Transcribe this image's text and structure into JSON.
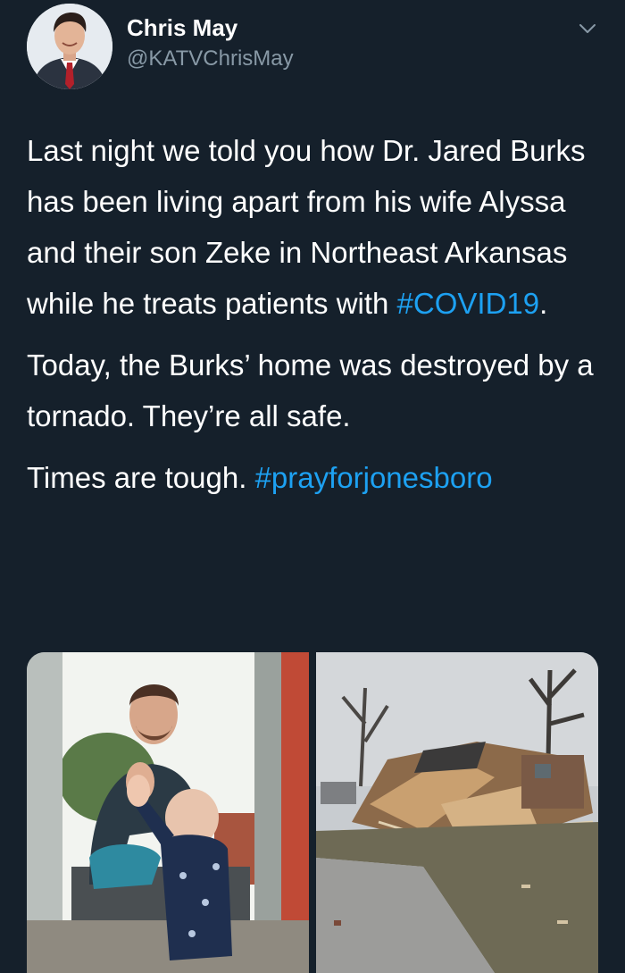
{
  "user": {
    "display_name": "Chris May",
    "handle": "@KATVChrisMay"
  },
  "tweet": {
    "p1_text": "Last night we told you how Dr. Jared Burks has been living apart from his wife Alyssa and their son Zeke in Northeast Arkansas while he treats patients with ",
    "p1_hashtag": "#COVID19",
    "p1_end": ".",
    "p2_text": "Today, the Burks’ home was destroyed by a tornado. They’re all safe.",
    "p3_text": "Times are tough. ",
    "p3_hashtag": "#prayforjonesboro"
  },
  "media": [
    {
      "description_icon": "photo-doctor-and-child"
    },
    {
      "description_icon": "photo-tornado-damage"
    }
  ],
  "colors": {
    "background": "#15202b",
    "text": "#ffffff",
    "secondary_text": "#8899a6",
    "link": "#1da1f2"
  }
}
